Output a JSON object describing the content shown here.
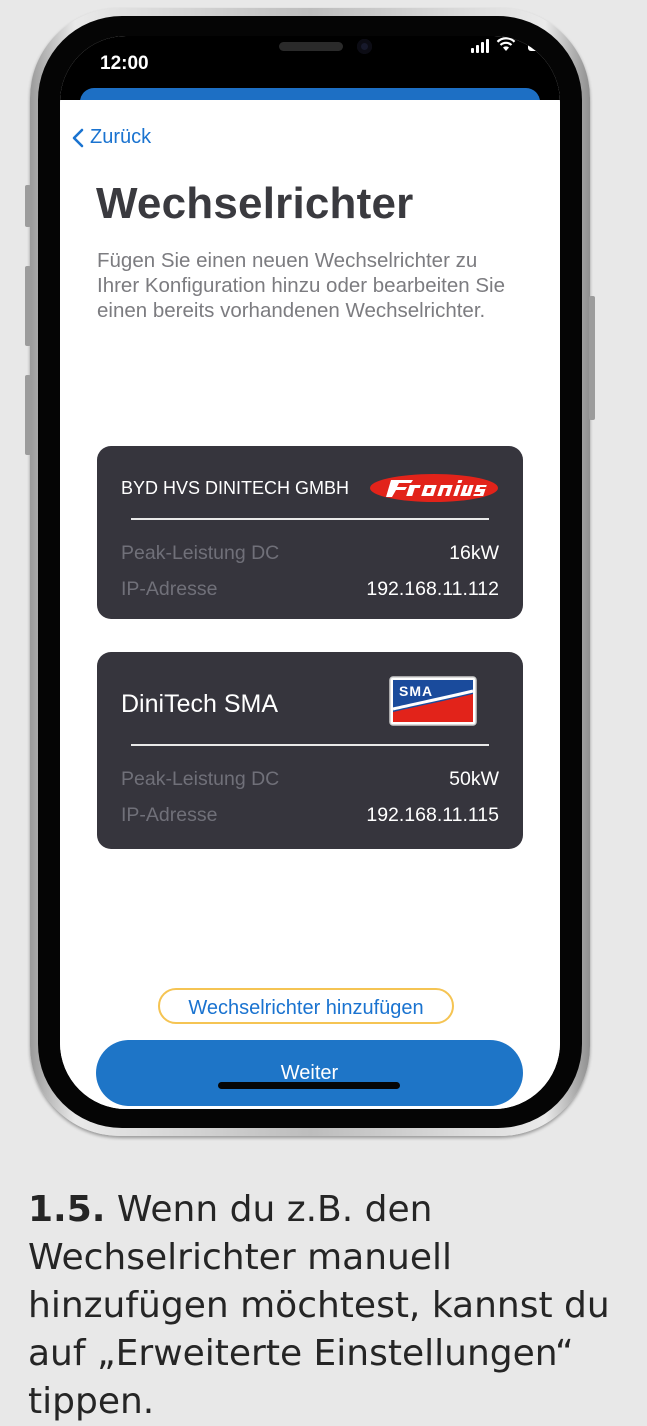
{
  "status_bar": {
    "time": "12:00"
  },
  "nav": {
    "back_label": "Zurück"
  },
  "page": {
    "title": "Wechselrichter",
    "subtitle": "Fügen Sie einen neuen Wechselrichter zu Ihrer Konfiguration hinzu oder bearbeiten Sie einen bereits vorhandenen Wechselrichter."
  },
  "inverters": [
    {
      "name": "BYD HVS DINITECH GMBH",
      "brand": "Fronius",
      "peak_label": "Peak-Leistung DC",
      "peak_value": "16kW",
      "ip_label": "IP-Adresse",
      "ip_value": "192.168.11.112"
    },
    {
      "name": "DiniTech SMA",
      "brand": "SMA",
      "peak_label": "Peak-Leistung DC",
      "peak_value": "50kW",
      "ip_label": "IP-Adresse",
      "ip_value": "192.168.11.115"
    }
  ],
  "actions": {
    "add_label": "Wechselrichter hinzufügen",
    "next_label": "Weiter"
  },
  "caption": {
    "step": "1.5.",
    "text": " Wenn du z.B. den Wechselrichter manuell hinzufügen möchtest, kannst du auf „Erweiterte Einstellungen“ tippen."
  },
  "colors": {
    "accent": "#1e75c7",
    "card_bg": "#36353d",
    "highlight": "#f5c453",
    "fronius_red": "#e2231a",
    "sma_blue": "#1a4b9c"
  }
}
